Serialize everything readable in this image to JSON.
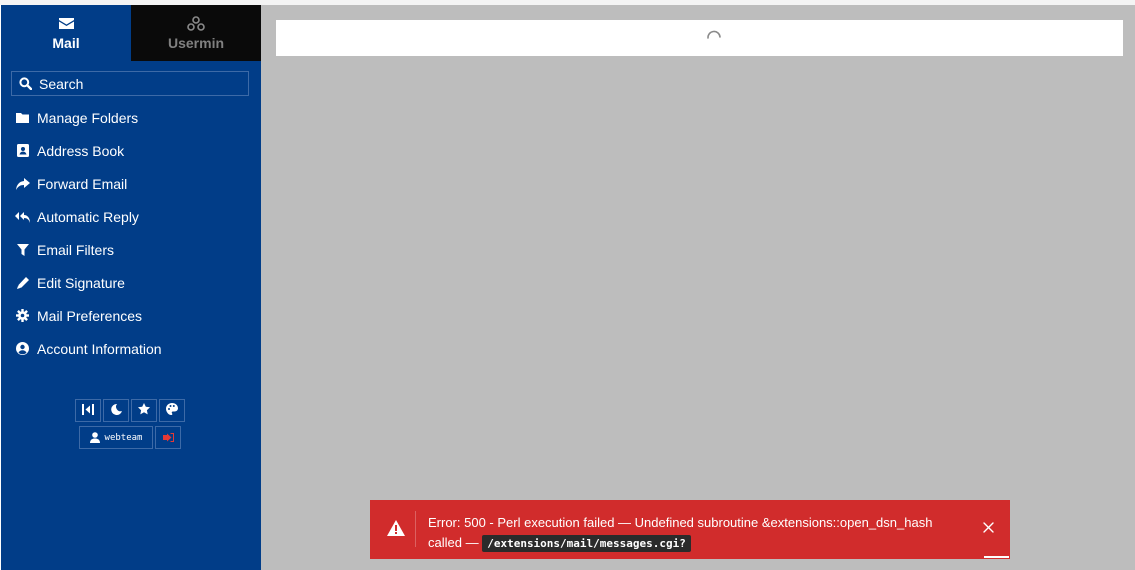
{
  "tabs": [
    {
      "label": "Mail",
      "icon": "envelope-icon",
      "active": true
    },
    {
      "label": "Usermin",
      "icon": "usermin-logo-icon",
      "active": false
    }
  ],
  "search": {
    "label": "Search",
    "icon": "search-icon"
  },
  "menu": [
    {
      "label": "Manage Folders",
      "icon": "folder-icon"
    },
    {
      "label": "Address Book",
      "icon": "address-book-icon"
    },
    {
      "label": "Forward Email",
      "icon": "share-icon"
    },
    {
      "label": "Automatic Reply",
      "icon": "reply-all-icon"
    },
    {
      "label": "Email Filters",
      "icon": "filter-icon"
    },
    {
      "label": "Edit Signature",
      "icon": "pencil-icon"
    },
    {
      "label": "Mail Preferences",
      "icon": "gear-icon"
    },
    {
      "label": "Account Information",
      "icon": "user-circle-icon"
    }
  ],
  "tools": [
    "collapse-sidebar-icon",
    "moon-icon",
    "star-icon",
    "palette-icon"
  ],
  "user": {
    "name": "webteam",
    "icon": "user-icon",
    "logout_icon": "logout-icon"
  },
  "toast": {
    "message": "Error:  500 - Perl execution failed — Undefined subroutine &extensions::open_dsn_hash called —",
    "code": "/extensions/mail/messages.cgi?",
    "icon": "warning-icon",
    "close_icon": "close-icon"
  },
  "colors": {
    "sidebar": "#013d88",
    "inactive_tab": "#0a0a0a",
    "main_bg": "#bdbdbd",
    "error": "#d12c2c",
    "logout_accent": "#e53935"
  }
}
